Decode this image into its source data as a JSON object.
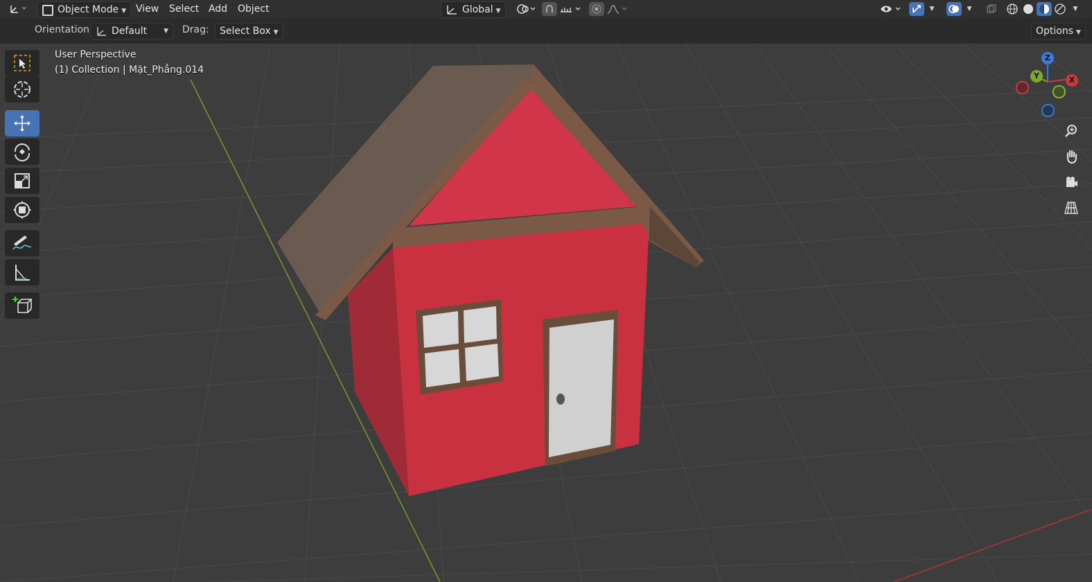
{
  "header": {
    "mode_label": "Object Mode",
    "menus": [
      "View",
      "Select",
      "Add",
      "Object"
    ],
    "transform_orientation": "Global",
    "options_label": "Options"
  },
  "tool_settings": {
    "orientation_label": "Orientation:",
    "orientation_value": "Default",
    "drag_label": "Drag:",
    "drag_value": "Select Box"
  },
  "viewport": {
    "view_name": "User Perspective",
    "collection_info": "(1) Collection | Mặt_Phẳng.014",
    "gizmo": {
      "z": "Z",
      "y": "Y",
      "x": "X"
    }
  },
  "toolbar": {
    "items": [
      "select-box-icon",
      "cursor-icon",
      "move-icon",
      "rotate-icon",
      "scale-icon",
      "transform-icon",
      "annotate-icon",
      "measure-icon",
      "add-cube-icon"
    ],
    "active": "move-icon"
  },
  "colors": {
    "accent": "#4772b3",
    "house_wall": "#c93040",
    "roof": "#6b5a50",
    "trim": "#7a5a46",
    "window_glass": "#d7d7d7",
    "axis_y": "#8fb32e",
    "axis_x": "#c83a3a"
  }
}
